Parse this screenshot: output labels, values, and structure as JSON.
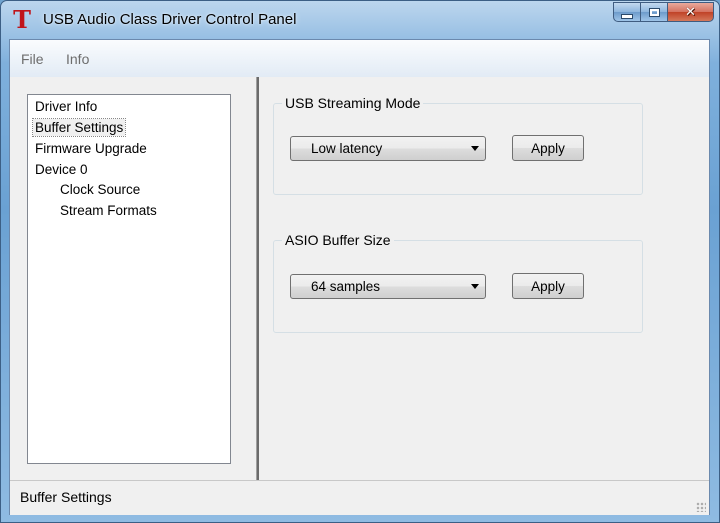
{
  "window": {
    "title": "USB Audio Class Driver Control Panel",
    "icon_glyph": "T",
    "icon_color": "#c0141a",
    "controls": {
      "minimize": "minimize-icon",
      "maximize": "maximize-icon",
      "close": "close-icon",
      "close_glyph": "✕"
    }
  },
  "menu": {
    "file": "File",
    "info": "Info"
  },
  "tree": {
    "items": [
      {
        "label": "Driver Info"
      },
      {
        "label": "Buffer Settings",
        "selected": true
      },
      {
        "label": "Firmware Upgrade"
      },
      {
        "label": "Device 0"
      },
      {
        "label": "Clock Source"
      },
      {
        "label": "Stream Formats"
      }
    ]
  },
  "usb_streaming": {
    "title": "USB Streaming Mode",
    "selected": "Low latency",
    "apply_label": "Apply"
  },
  "asio_buffer": {
    "title": "ASIO Buffer Size",
    "selected": "64 samples",
    "apply_label": "Apply"
  },
  "status": {
    "text": "Buffer Settings"
  }
}
